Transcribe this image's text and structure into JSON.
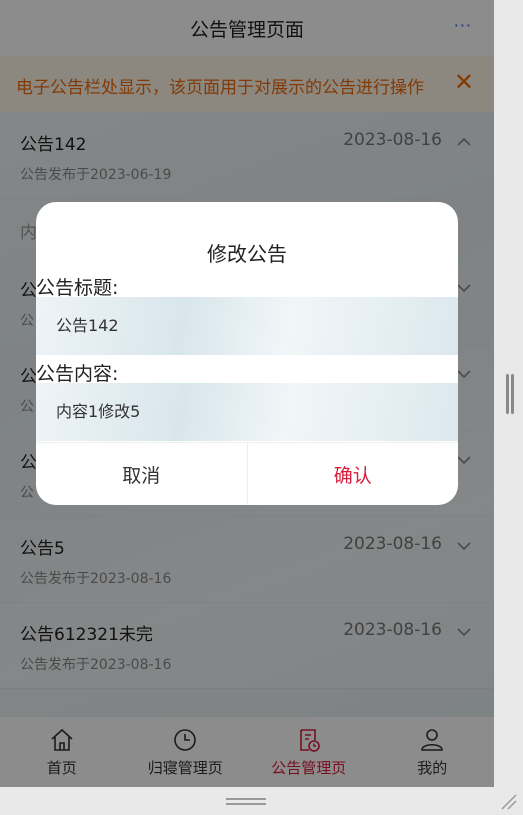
{
  "navbar": {
    "title": "公告管理页面",
    "more": "···"
  },
  "notice": {
    "text": "电子公告栏处显示，该页面用于对展示的公告进行操作",
    "close": "✕"
  },
  "list": [
    {
      "title": "公告142",
      "sub": "公告发布于2023-06-19",
      "date": "2023-08-16",
      "expanded": true
    },
    {
      "title": "内",
      "sub": "",
      "date": "",
      "expanded": false
    },
    {
      "title": "公",
      "sub": "公",
      "date": "",
      "expanded": false
    },
    {
      "title": "公",
      "sub": "公",
      "date": "",
      "expanded": false
    },
    {
      "title": "公",
      "sub": "公",
      "date": "",
      "expanded": false
    },
    {
      "title": "公告5",
      "sub": "公告发布于2023-08-16",
      "date": "2023-08-16",
      "expanded": false
    },
    {
      "title": "公告612321未完",
      "sub": "公告发布于2023-08-16",
      "date": "2023-08-16",
      "expanded": false
    }
  ],
  "tabbar": [
    {
      "label": "首页",
      "icon": "home-icon",
      "active": false
    },
    {
      "label": "归寝管理页",
      "icon": "clock-icon",
      "active": false
    },
    {
      "label": "公告管理页",
      "icon": "notice-icon",
      "active": true
    },
    {
      "label": "我的",
      "icon": "user-icon",
      "active": false
    }
  ],
  "dialog": {
    "title": "修改公告",
    "title_label": "公告标题:",
    "title_value": "公告142",
    "content_label": "公告内容:",
    "content_value": "内容1修改5",
    "cancel": "取消",
    "confirm": "确认"
  },
  "colors": {
    "accent": "#d81e3c",
    "notice": "#ed6a0c",
    "link": "#3b5bdb"
  }
}
